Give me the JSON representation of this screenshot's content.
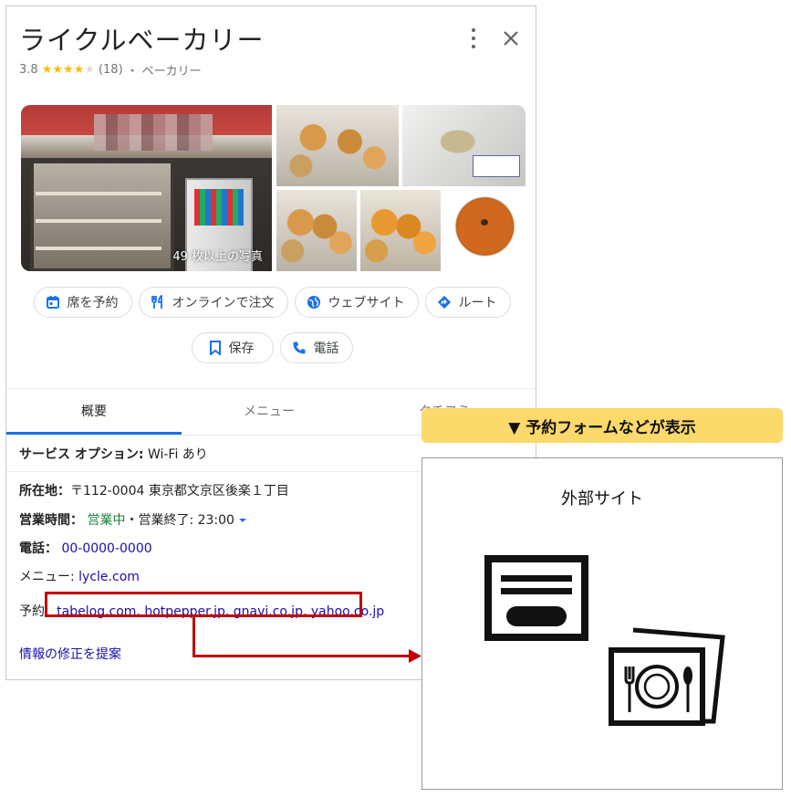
{
  "place": {
    "name": "ライクルベーカリー",
    "rating": "3.8",
    "stars_filled": 4,
    "stars_total": 5,
    "review_count": "(18)",
    "separator": "・",
    "category": "ベーカリー"
  },
  "photos": {
    "caption": "49 枚以上の写真"
  },
  "actions": {
    "reserve": "席を予約",
    "order_online": "オンラインで注文",
    "website": "ウェブサイト",
    "route": "ルート",
    "save": "保存",
    "call": "電話"
  },
  "tabs": {
    "overview": "概要",
    "menu": "メニュー",
    "reviews": "クチコミ"
  },
  "details": {
    "service_label": "サービス オプション:",
    "service_value": "Wi-Fi あり",
    "address_label": "所在地：",
    "address_value": "〒112-0004 東京都文京区後楽１丁目",
    "hours_label": "営業時間：",
    "hours_open": "営業中",
    "hours_rest": "・営業終了: 23:00",
    "phone_label": "電話：",
    "phone_value": "00-0000-0000",
    "menu_label": "メニュー:",
    "menu_value": "lycle.com",
    "reserve_label": "予約:",
    "reserve_value": "tabelog.com, hotpepper.jp, gnavi.co.jp, yahoo.co.jp",
    "suggest_edit": "情報の修正を提案"
  },
  "callout": {
    "text": "▼ 予約フォームなどが表示"
  },
  "external": {
    "title": "外部サイト"
  },
  "colors": {
    "link": "#1a0dab",
    "open_green": "#188038",
    "accent_blue": "#1a73e8",
    "highlight_red": "#c00000",
    "callout_yellow": "#fbd96a",
    "star": "#fbbc04"
  }
}
